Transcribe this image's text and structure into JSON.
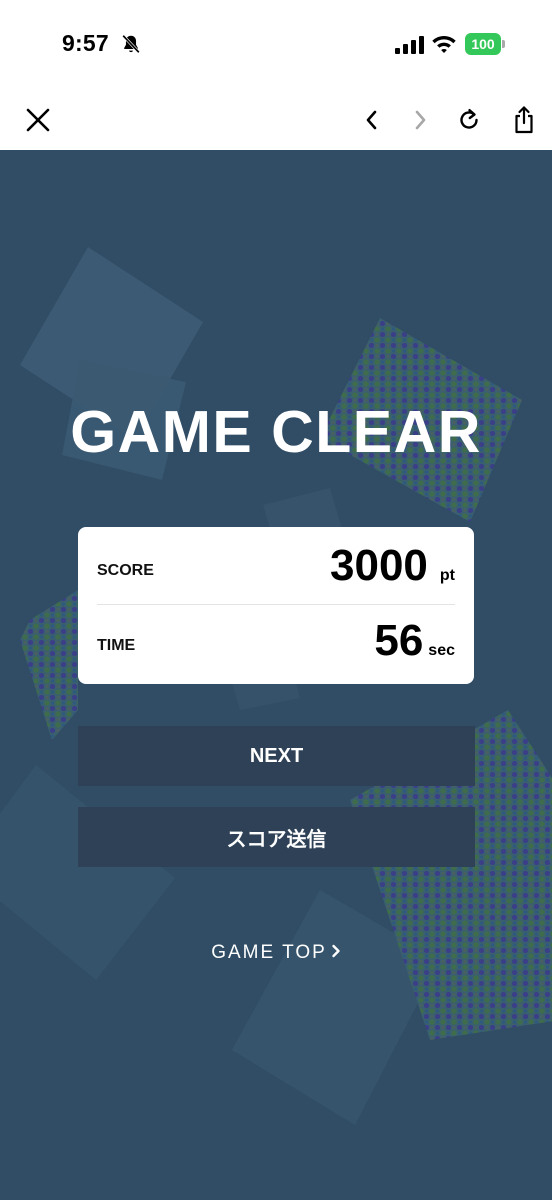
{
  "status_bar": {
    "time": "9:57",
    "battery": "100",
    "icons": [
      "bell-slash-icon",
      "cellular-signal-icon",
      "wifi-icon",
      "battery-icon"
    ]
  },
  "toolbar": {
    "icons": [
      "close-icon",
      "back-chevron-icon",
      "forward-chevron-icon",
      "reload-icon",
      "share-icon"
    ]
  },
  "game": {
    "title": "GAME CLEAR",
    "result": {
      "score_label": "SCORE",
      "score_value": "3000",
      "score_unit": "pt",
      "time_label": "TIME",
      "time_value": "56",
      "time_unit": "sec"
    },
    "next_button": "NEXT",
    "send_score_button": "スコア送信",
    "game_top_link": "GAME TOP"
  },
  "colors": {
    "background": "#304d65",
    "button": "#2e4156",
    "card": "#ffffff",
    "battery": "#34c759"
  }
}
